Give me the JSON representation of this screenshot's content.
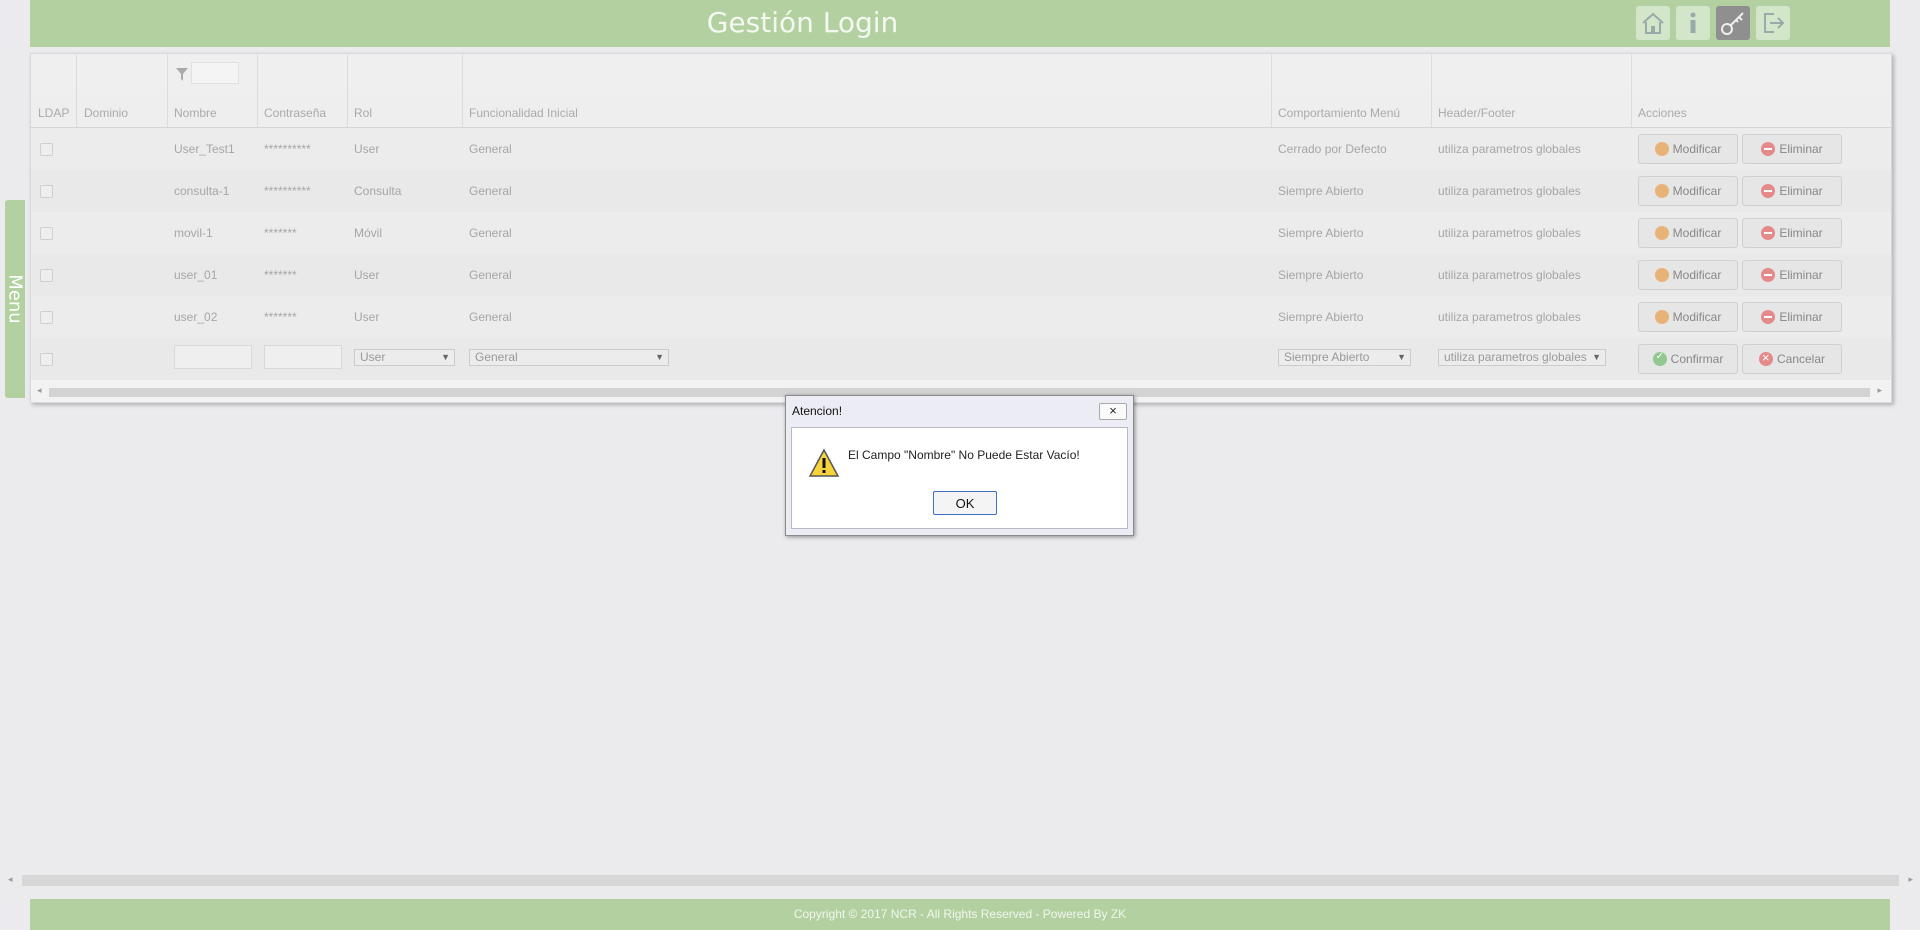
{
  "header": {
    "title": "Gestión Login",
    "buttons": [
      {
        "name": "home-icon"
      },
      {
        "name": "info-icon"
      },
      {
        "name": "key-icon",
        "active": true
      },
      {
        "name": "logout-icon"
      }
    ]
  },
  "menu_tab": {
    "label": "Menu"
  },
  "grid": {
    "columns": [
      "LDAP",
      "Dominio",
      "Nombre",
      "Contraseña",
      "Rol",
      "Funcionalidad Inicial",
      "Comportamiento Menú",
      "Header/Footer",
      "Acciones"
    ],
    "rows": [
      {
        "nombre": "User_Test1",
        "password": "**********",
        "rol": "User",
        "funcionalidad": "General",
        "comportamiento": "Cerrado por Defecto",
        "header_footer": "utiliza parametros globales"
      },
      {
        "nombre": "consulta-1",
        "password": "**********",
        "rol": "Consulta",
        "funcionalidad": "General",
        "comportamiento": "Siempre Abierto",
        "header_footer": "utiliza parametros globales"
      },
      {
        "nombre": "movil-1",
        "password": "*******",
        "rol": "Móvil",
        "funcionalidad": "General",
        "comportamiento": "Siempre Abierto",
        "header_footer": "utiliza parametros globales"
      },
      {
        "nombre": "user_01",
        "password": "*******",
        "rol": "User",
        "funcionalidad": "General",
        "comportamiento": "Siempre Abierto",
        "header_footer": "utiliza parametros globales"
      },
      {
        "nombre": "user_02",
        "password": "*******",
        "rol": "User",
        "funcionalidad": "General",
        "comportamiento": "Siempre Abierto",
        "header_footer": "utiliza parametros globales"
      }
    ],
    "modify_label": "Modificar",
    "delete_label": "Eliminar",
    "new_row": {
      "rol_selected": "User",
      "funcionalidad_selected": "General",
      "comportamiento_selected": "Siempre Abierto",
      "header_footer_selected": "utiliza parametros globales",
      "confirm_label": "Confirmar",
      "cancel_label": "Cancelar"
    }
  },
  "dialog": {
    "title": "Atencion!",
    "close_label": "×",
    "message": "El Campo \"Nombre\" No Puede Estar Vacío!",
    "ok_label": "OK"
  },
  "footer": {
    "text": "Copyright © 2017 NCR - All Rights Reserved - Powered By ZK"
  },
  "colors": {
    "header": "#b3d1a0",
    "background": "#ebebed",
    "dialog_ok_border": "#3f6fbf"
  }
}
